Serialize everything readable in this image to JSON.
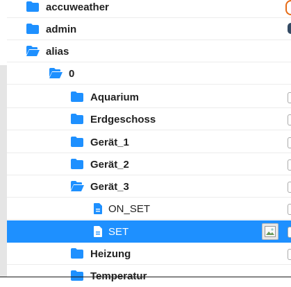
{
  "tree": {
    "items": [
      {
        "label": "accuweather",
        "icon": "folder-icon",
        "bold": true
      },
      {
        "label": "admin",
        "icon": "folder-icon",
        "bold": true
      },
      {
        "label": "alias",
        "icon": "folder-open-icon",
        "bold": true
      },
      {
        "label": "0",
        "icon": "folder-open-icon",
        "bold": true
      },
      {
        "label": "Aquarium",
        "icon": "folder-icon",
        "bold": true
      },
      {
        "label": "Erdgeschoss",
        "icon": "folder-icon",
        "bold": true
      },
      {
        "label": "Gerät_1",
        "icon": "folder-icon",
        "bold": true
      },
      {
        "label": "Gerät_2",
        "icon": "folder-icon",
        "bold": true
      },
      {
        "label": "Gerät_3",
        "icon": "folder-open-icon",
        "bold": true
      },
      {
        "label": "ON_SET",
        "icon": "file-icon",
        "bold": false
      },
      {
        "label": "SET",
        "icon": "file-icon",
        "bold": false,
        "selected": true
      },
      {
        "label": "Heizung",
        "icon": "folder-icon",
        "bold": true
      },
      {
        "label": "Temperatur",
        "icon": "folder-icon",
        "bold": true
      }
    ]
  },
  "colors": {
    "accent": "#1e90ff",
    "folder": "#1e90ff"
  }
}
